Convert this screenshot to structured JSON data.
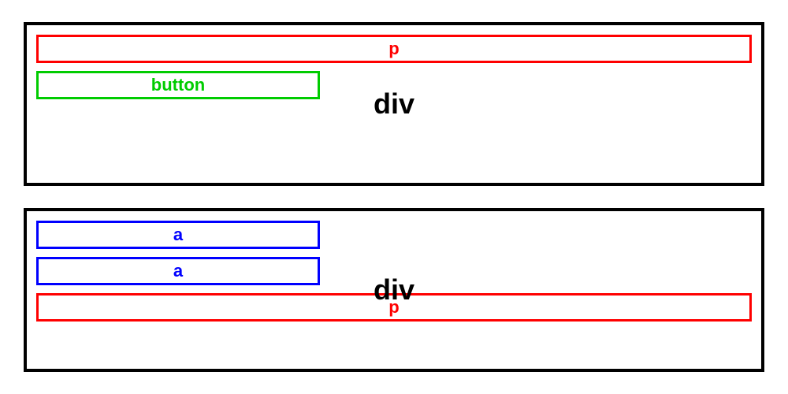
{
  "container1": {
    "label": "div",
    "children": [
      {
        "type": "p",
        "label": "p"
      },
      {
        "type": "button",
        "label": "button"
      }
    ]
  },
  "container2": {
    "label": "div",
    "children": [
      {
        "type": "a",
        "label": "a"
      },
      {
        "type": "a",
        "label": "a"
      },
      {
        "type": "p",
        "label": "p"
      }
    ]
  }
}
